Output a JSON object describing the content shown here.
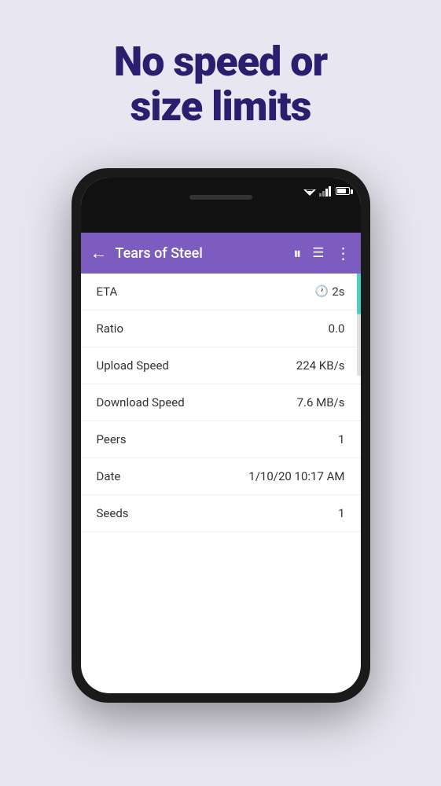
{
  "headline": {
    "line1": "No speed or",
    "line2": "size limits"
  },
  "phone": {
    "appBar": {
      "title": "Tears of Steel",
      "backIcon": "←",
      "pauseIcon": "⏸",
      "listIcon": "☰",
      "moreIcon": "⋮"
    },
    "rows": [
      {
        "label": "ETA",
        "value": "2s",
        "hasClockIcon": true
      },
      {
        "label": "Ratio",
        "value": "0.0",
        "hasClockIcon": false
      },
      {
        "label": "Upload Speed",
        "value": "224 KB/s",
        "hasClockIcon": false
      },
      {
        "label": "Download Speed",
        "value": "7.6 MB/s",
        "hasClockIcon": false
      },
      {
        "label": "Peers",
        "value": "1",
        "hasClockIcon": false
      },
      {
        "label": "Date",
        "value": "1/10/20 10:17 AM",
        "hasClockIcon": false
      },
      {
        "label": "Seeds",
        "value": "1",
        "hasClockIcon": false
      }
    ]
  },
  "colors": {
    "background": "#e8e6f0",
    "headlineColor": "#2a1f6e",
    "appBarColor": "#7c5cbf",
    "progressColor": "#4dd0c4"
  }
}
